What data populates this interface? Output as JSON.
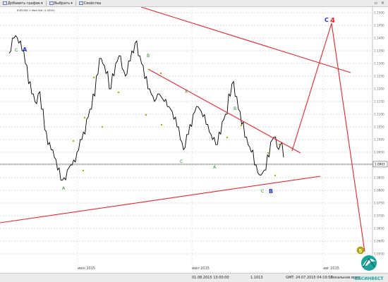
{
  "toolbar": {
    "add_chart_label": "Добавить график",
    "choose_label": "Выбрать",
    "properties_label": "Свойства"
  },
  "chart_title": "EURUSD 1 Мин Bid (1.0050)",
  "colors": {
    "price_line": "#000000",
    "trend_line": "#e8232c",
    "wave_green": "#1e8c1e",
    "wave_blue": "#1a2fd6",
    "wave_yellow": "#b8a800",
    "grid": "#b4b4b4",
    "current_line": "#555555"
  },
  "chart_data": {
    "type": "line",
    "title": "",
    "xlabel": "",
    "ylabel": "",
    "grid": true,
    "price_axis_ticks": [
      "1.1500",
      "1.1450",
      "1.1400",
      "1.1350",
      "1.1300",
      "1.1250",
      "1.1200",
      "1.1150",
      "1.1100",
      "1.1050",
      "1.1000",
      "1.0950",
      "1.0900",
      "1.0850",
      "1.0800",
      "1.0750",
      "1.0700",
      "1.0650",
      "1.0600",
      "1.0550",
      "1.0500"
    ],
    "time_labels": [
      "июн 2015",
      "июл 2015",
      "авг 2015"
    ],
    "current_price": "1.0903",
    "wave_labels": [
      {
        "text": "C",
        "color": "green"
      },
      {
        "text": "A",
        "color": "blue"
      },
      {
        "text": "B",
        "color": "green"
      },
      {
        "text": "X",
        "color": "green"
      },
      {
        "text": "B",
        "color": "green"
      },
      {
        "text": "C",
        "color": "green"
      },
      {
        "text": "A",
        "color": "green"
      },
      {
        "text": "A",
        "color": "green"
      },
      {
        "text": "C",
        "color": "green"
      },
      {
        "text": "B",
        "color": "blue"
      },
      {
        "text": "C",
        "color": "blue"
      },
      {
        "text": "4",
        "color": "red"
      },
      {
        "text": "5",
        "color": "yellow"
      }
    ],
    "series": [
      {
        "values": [
          1.134,
          1.14,
          1.141,
          1.138,
          1.135,
          1.13,
          1.122,
          1.118,
          1.115,
          1.118,
          1.112,
          1.104,
          1.098,
          1.096,
          1.093,
          1.088,
          1.084,
          1.085,
          1.088,
          1.09,
          1.092,
          1.095,
          1.1,
          1.103,
          1.108,
          1.112,
          1.118,
          1.125,
          1.132,
          1.13,
          1.126,
          1.12,
          1.126,
          1.13,
          1.133,
          1.128,
          1.125,
          1.131,
          1.135,
          1.138,
          1.133,
          1.13,
          1.124,
          1.12,
          1.118,
          1.115,
          1.118,
          1.117,
          1.115,
          1.113,
          1.112,
          1.108,
          1.105,
          1.1,
          1.096,
          1.102,
          1.106,
          1.11,
          1.113,
          1.112,
          1.109,
          1.106,
          1.103,
          1.1,
          1.098,
          1.103,
          1.107,
          1.11,
          1.118,
          1.122,
          1.117,
          1.112,
          1.106,
          1.101,
          1.098,
          1.095,
          1.09,
          1.087,
          1.086,
          1.088,
          1.094,
          1.099,
          1.101,
          1.097,
          1.098,
          1.093
        ]
      }
    ]
  },
  "statusbar": {
    "datetime": "01.08.2015 13:00:00",
    "price": "1.1013",
    "gmt": "GMT: 24.07.2015 04:19:56",
    "local_time": "Локальное врем"
  },
  "logo": {
    "text": "ВАСИНВЕСТ"
  }
}
